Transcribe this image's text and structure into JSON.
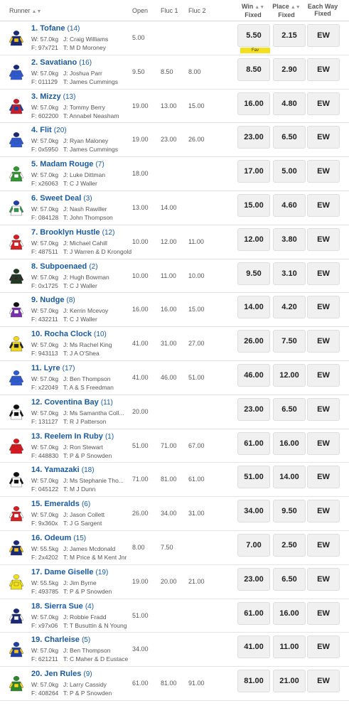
{
  "header": {
    "runner": "Runner",
    "open": "Open",
    "fluc1": "Fluc 1",
    "fluc2": "Fluc 2",
    "win_line1": "Win",
    "win_line2": "Fixed",
    "place_line1": "Place",
    "place_line2": "Fixed",
    "ew_line1": "Each Way",
    "ew_line2": "Fixed"
  },
  "labels": {
    "ew": "EW",
    "fav": "Fav"
  },
  "runners": [
    {
      "name": "1. Tofane",
      "barrier": "(14)",
      "weight": "W: 57.0kg",
      "jockey": "J: Craig Williams",
      "form": "F: 97x721",
      "trainer": "T: M D Moroney",
      "open": "5.00",
      "fluc1": "",
      "fluc2": "",
      "win": "5.50",
      "place": "2.15",
      "fav": true,
      "silk": [
        "#1a2a7a",
        "#f2c418",
        "#1a2a7a"
      ]
    },
    {
      "name": "2. Savatiano",
      "barrier": "(16)",
      "weight": "W: 57.0kg",
      "jockey": "J: Joshua Parr",
      "form": "F: 011129",
      "trainer": "T: James Cummings",
      "open": "9.50",
      "fluc1": "8.50",
      "fluc2": "8.00",
      "win": "8.50",
      "place": "2.90",
      "fav": false,
      "silk": [
        "#2d5bd8",
        "#2d5bd8",
        "#1a2a7a"
      ]
    },
    {
      "name": "3. Mizzy",
      "barrier": "(13)",
      "weight": "W: 57.0kg",
      "jockey": "J: Tommy Berry",
      "form": "F: 602200",
      "trainer": "T: Annabel Neasham",
      "open": "19.00",
      "fluc1": "13.00",
      "fluc2": "15.00",
      "win": "16.00",
      "place": "4.80",
      "fav": false,
      "silk": [
        "#cc1d2c",
        "#1f3fa8",
        "#cc1d2c"
      ]
    },
    {
      "name": "4. Flit",
      "barrier": "(20)",
      "weight": "W: 57.0kg",
      "jockey": "J: Ryan Maloney",
      "form": "F: 0x5950",
      "trainer": "T: James Cummings",
      "open": "19.00",
      "fluc1": "23.00",
      "fluc2": "26.00",
      "win": "23.00",
      "place": "6.50",
      "fav": false,
      "silk": [
        "#2d5bd8",
        "#2d5bd8",
        "#1a2a7a"
      ]
    },
    {
      "name": "5. Madam Rouge",
      "barrier": "(7)",
      "weight": "W: 57.0kg",
      "jockey": "J: Luke Dittman",
      "form": "F: x26063",
      "trainer": "T: C J Waller",
      "open": "18.00",
      "fluc1": "",
      "fluc2": "",
      "win": "17.00",
      "place": "5.00",
      "fav": false,
      "silk": [
        "#2f9a2f",
        "#ffffff",
        "#2f9a2f"
      ]
    },
    {
      "name": "6. Sweet Deal",
      "barrier": "(3)",
      "weight": "W: 57.0kg",
      "jockey": "J: Nash Rawiller",
      "form": "F: 084128",
      "trainer": "T: John Thompson",
      "open": "13.00",
      "fluc1": "14.00",
      "fluc2": "",
      "win": "15.00",
      "place": "4.60",
      "fav": false,
      "silk": [
        "#ffffff",
        "#2f9a4a",
        "#1f3fa8"
      ]
    },
    {
      "name": "7. Brooklyn Hustle",
      "barrier": "(12)",
      "weight": "W: 57.0kg",
      "jockey": "J: Michael Cahill",
      "form": "F: 487511",
      "trainer": "T: J Warren & D Krongold",
      "open": "10.00",
      "fluc1": "12.00",
      "fluc2": "11.00",
      "win": "12.00",
      "place": "3.80",
      "fav": false,
      "silk": [
        "#d81f26",
        "#ffffff",
        "#d81f26"
      ]
    },
    {
      "name": "8. Subpoenaed",
      "barrier": "(2)",
      "weight": "W: 57.0kg",
      "jockey": "J: Hugh Bowman",
      "form": "F: 0x1725",
      "trainer": "T: C J Waller",
      "open": "10.00",
      "fluc1": "11.00",
      "fluc2": "10.00",
      "win": "9.50",
      "place": "3.10",
      "fav": false,
      "silk": [
        "#1f3a1f",
        "#2a2a2a",
        "#1f3a1f"
      ]
    },
    {
      "name": "9. Nudge",
      "barrier": "(8)",
      "weight": "W: 57.0kg",
      "jockey": "J: Kerrin Mcevoy",
      "form": "F: 432211",
      "trainer": "T: C J Waller",
      "open": "16.00",
      "fluc1": "16.00",
      "fluc2": "15.00",
      "win": "14.00",
      "place": "4.20",
      "fav": false,
      "silk": [
        "#7a2fb0",
        "#ffffff",
        "#111111"
      ]
    },
    {
      "name": "10. Rocha Clock",
      "barrier": "(10)",
      "weight": "W: 57.0kg",
      "jockey": "J: Ms Rachel King",
      "form": "F: 943113",
      "trainer": "T: J A O'Shea",
      "open": "41.00",
      "fluc1": "31.00",
      "fluc2": "27.00",
      "win": "26.00",
      "place": "7.50",
      "fav": false,
      "silk": [
        "#f2d81a",
        "#222222",
        "#f2d81a"
      ]
    },
    {
      "name": "11. Lyre",
      "barrier": "(17)",
      "weight": "W: 57.0kg",
      "jockey": "J: Ben Thompson",
      "form": "F: x22049",
      "trainer": "T: A & S Freedman",
      "open": "41.00",
      "fluc1": "46.00",
      "fluc2": "51.00",
      "win": "46.00",
      "place": "12.00",
      "fav": false,
      "silk": [
        "#2d5bd8",
        "#2d5bd8",
        "#2d5bd8"
      ]
    },
    {
      "name": "12. Coventina Bay",
      "barrier": "(11)",
      "weight": "W: 57.0kg",
      "jockey": "J: Ms Samantha Coll...",
      "form": "F: 131127",
      "trainer": "T: R J Patterson",
      "open": "20.00",
      "fluc1": "",
      "fluc2": "",
      "win": "23.00",
      "place": "6.50",
      "fav": false,
      "silk": [
        "#ffffff",
        "#111111",
        "#111111"
      ]
    },
    {
      "name": "13. Reelem In Ruby",
      "barrier": "(1)",
      "weight": "W: 57.0kg",
      "jockey": "J: Ron Stewart",
      "form": "F: 448830",
      "trainer": "T: P & P Snowden",
      "open": "51.00",
      "fluc1": "71.00",
      "fluc2": "67.00",
      "win": "61.00",
      "place": "16.00",
      "fav": false,
      "silk": [
        "#e0161e",
        "#e0161e",
        "#e0161e"
      ]
    },
    {
      "name": "14. Yamazaki",
      "barrier": "(18)",
      "weight": "W: 57.0kg",
      "jockey": "J: Ms Stephanie Tho...",
      "form": "F: 045122",
      "trainer": "T: M J Dunn",
      "open": "71.00",
      "fluc1": "81.00",
      "fluc2": "61.00",
      "win": "51.00",
      "place": "14.00",
      "fav": false,
      "silk": [
        "#ffffff",
        "#111111",
        "#111111"
      ]
    },
    {
      "name": "15. Emeralds",
      "barrier": "(6)",
      "weight": "W: 57.0kg",
      "jockey": "J: Jason Collett",
      "form": "F: 9x360x",
      "trainer": "T: J G Sargent",
      "open": "26.00",
      "fluc1": "34.00",
      "fluc2": "31.00",
      "win": "34.00",
      "place": "9.50",
      "fav": false,
      "silk": [
        "#d81f26",
        "#ffffff",
        "#d81f26"
      ]
    },
    {
      "name": "16. Odeum",
      "barrier": "(15)",
      "weight": "W: 55.5kg",
      "jockey": "J: James Mcdonald",
      "form": "F: 2x4202",
      "trainer": "T: M Price & M Kent Jnr",
      "open": "8.00",
      "fluc1": "7.50",
      "fluc2": "",
      "win": "7.00",
      "place": "2.50",
      "fav": false,
      "silk": [
        "#1a2a7a",
        "#f2c418",
        "#1a2a7a"
      ]
    },
    {
      "name": "17. Dame Giselle",
      "barrier": "(19)",
      "weight": "W: 55.5kg",
      "jockey": "J: Jim Byrne",
      "form": "F: 493785",
      "trainer": "T: P & P Snowden",
      "open": "19.00",
      "fluc1": "20.00",
      "fluc2": "21.00",
      "win": "23.00",
      "place": "6.50",
      "fav": false,
      "silk": [
        "#f2e21a",
        "#f2e21a",
        "#f2e21a"
      ]
    },
    {
      "name": "18. Sierra Sue",
      "barrier": "(4)",
      "weight": "W: 57.0kg",
      "jockey": "J: Robbie Fradd",
      "form": "F: x97x06",
      "trainer": "T: T Busuttin & N Young",
      "open": "51.00",
      "fluc1": "",
      "fluc2": "",
      "win": "61.00",
      "place": "16.00",
      "fav": false,
      "silk": [
        "#1a2a7a",
        "#ffffff",
        "#1a2a7a"
      ]
    },
    {
      "name": "19. Charleise",
      "barrier": "(5)",
      "weight": "W: 57.0kg",
      "jockey": "J: Ben Thompson",
      "form": "F: 621211",
      "trainer": "T: C Maher & D Eustace",
      "open": "34.00",
      "fluc1": "",
      "fluc2": "",
      "win": "41.00",
      "place": "11.00",
      "fav": false,
      "silk": [
        "#1f3fa8",
        "#f2c418",
        "#1f3fa8"
      ]
    },
    {
      "name": "20. Jen Rules",
      "barrier": "(9)",
      "weight": "W: 57.0kg",
      "jockey": "J: Larry Cassidy",
      "form": "F: 408264",
      "trainer": "T: P & P Snowden",
      "open": "61.00",
      "fluc1": "81.00",
      "fluc2": "91.00",
      "win": "81.00",
      "place": "21.00",
      "fav": false,
      "silk": [
        "#2a8a2a",
        "#f2d81a",
        "#2a8a2a"
      ]
    }
  ]
}
